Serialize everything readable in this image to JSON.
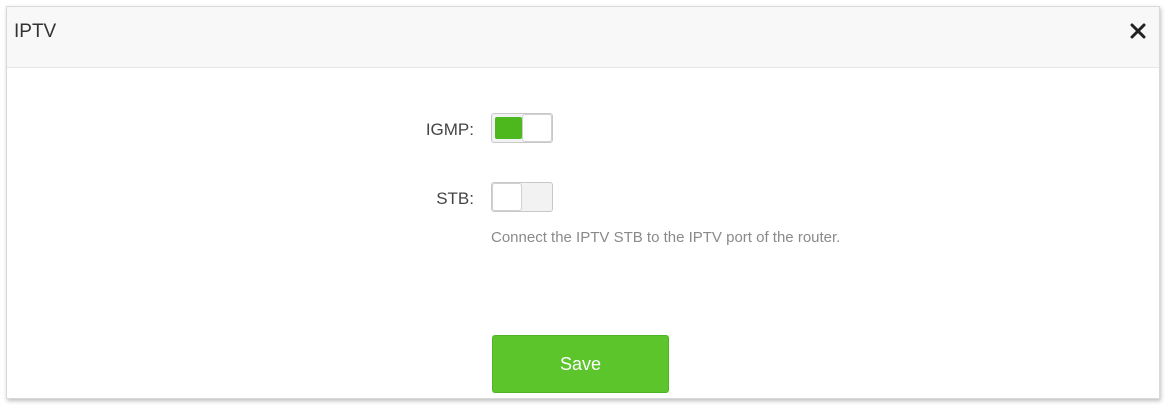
{
  "dialog": {
    "title": "IPTV",
    "close_icon": "close-icon"
  },
  "igmp": {
    "label": "IGMP:",
    "enabled": true
  },
  "stb": {
    "label": "STB:",
    "enabled": false,
    "hint": "Connect the IPTV STB to the IPTV port of the router."
  },
  "actions": {
    "save_label": "Save"
  },
  "colors": {
    "accent": "#5bc52b",
    "toggle_on": "#4cb81e",
    "hint_text": "#8a8a8a"
  }
}
